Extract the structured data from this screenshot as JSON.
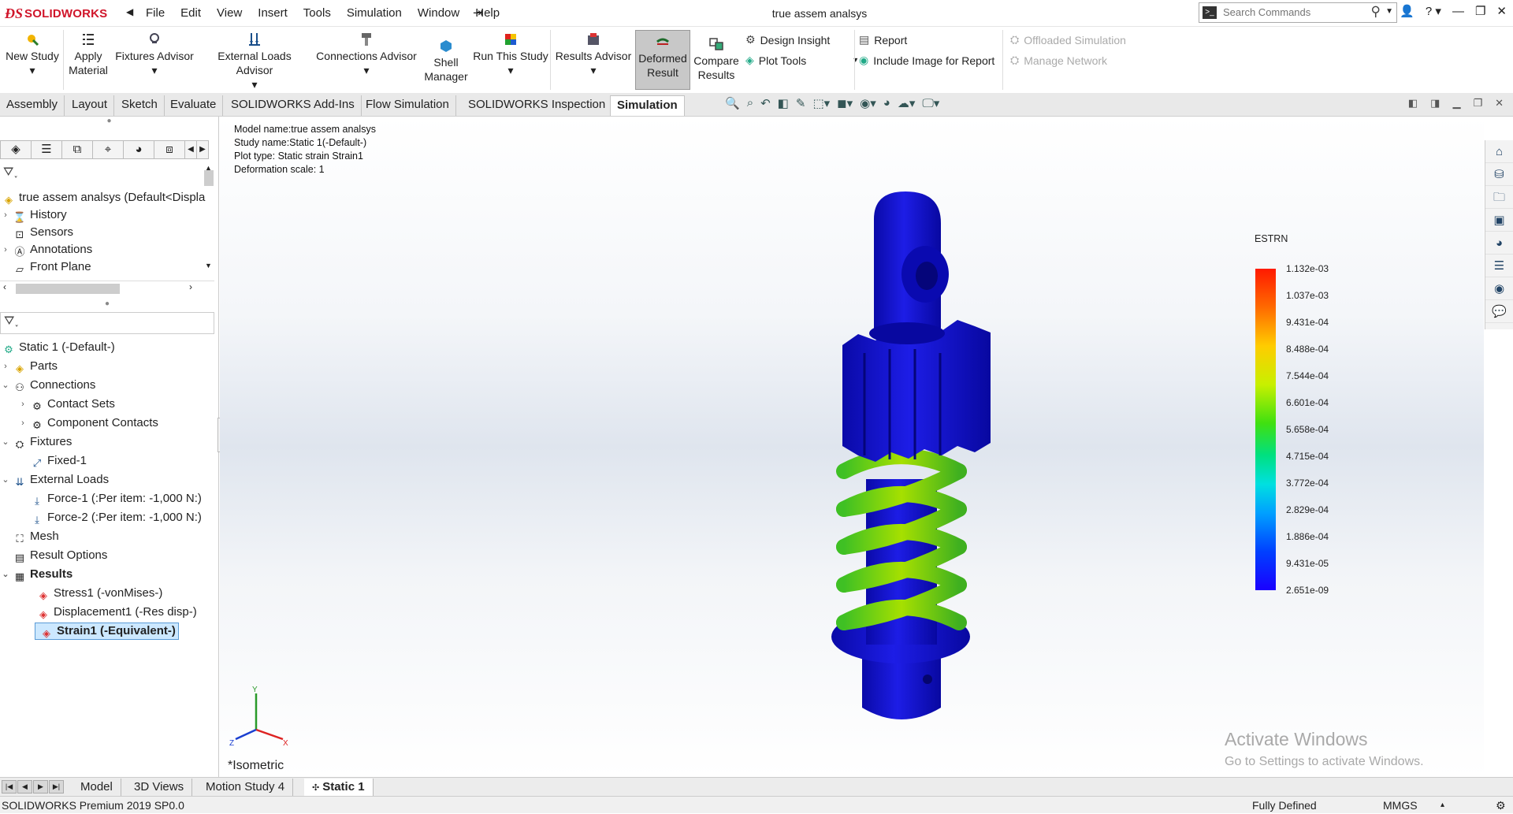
{
  "titlebar": {
    "app_name": "SOLIDWORKS",
    "menu": [
      "File",
      "Edit",
      "View",
      "Insert",
      "Tools",
      "Simulation",
      "Window",
      "Help"
    ],
    "document_title": "true assem analsys",
    "search_placeholder": "Search Commands"
  },
  "ribbon": {
    "new_study": "New Study",
    "apply_material_1": "Apply",
    "apply_material_2": "Material",
    "fixtures_advisor": "Fixtures Advisor",
    "external_loads_advisor": "External Loads Advisor",
    "connections_advisor": "Connections Advisor",
    "shell_manager_1": "Shell",
    "shell_manager_2": "Manager",
    "run_this_study": "Run This Study",
    "results_advisor": "Results Advisor",
    "deformed_result_1": "Deformed",
    "deformed_result_2": "Result",
    "compare_results_1": "Compare",
    "compare_results_2": "Results",
    "design_insight": "Design Insight",
    "plot_tools": "Plot Tools",
    "report": "Report",
    "include_image": "Include Image for Report",
    "offloaded_simulation": "Offloaded Simulation",
    "manage_network": "Manage Network"
  },
  "command_tabs": [
    "Assembly",
    "Layout",
    "Sketch",
    "Evaluate",
    "SOLIDWORKS Add-Ins",
    "Flow Simulation",
    "SOLIDWORKS Inspection",
    "Simulation"
  ],
  "feature_tree": {
    "root": "true assem analsys  (Default<Displa",
    "items": [
      "History",
      "Sensors",
      "Annotations",
      "Front Plane"
    ]
  },
  "study_tree": {
    "study": "Static 1 (-Default-)",
    "parts": "Parts",
    "connections": "Connections",
    "contact_sets": "Contact Sets",
    "component_contacts": "Component Contacts",
    "fixtures": "Fixtures",
    "fixed_1": "Fixed-1",
    "external_loads": "External Loads",
    "force_1": "Force-1 (:Per item: -1,000 N:)",
    "force_2": "Force-2 (:Per item: -1,000 N:)",
    "mesh": "Mesh",
    "result_options": "Result Options",
    "results": "Results",
    "stress1": "Stress1 (-vonMises-)",
    "displacement1": "Displacement1 (-Res disp-)",
    "strain1": "Strain1 (-Equivalent-)"
  },
  "viewport": {
    "model_name": "Model name:true assem analsys",
    "study_name": "Study name:Static 1(-Default-)",
    "plot_type": "Plot type: Static strain Strain1",
    "deformation_scale": "Deformation scale: 1",
    "legend_title": "ESTRN",
    "legend_ticks": [
      "1.132e-03",
      "1.037e-03",
      "9.431e-04",
      "8.488e-04",
      "7.544e-04",
      "6.601e-04",
      "5.658e-04",
      "4.715e-04",
      "3.772e-04",
      "2.829e-04",
      "1.886e-04",
      "9.431e-05",
      "2.651e-09"
    ],
    "view_orientation": "*Isometric",
    "activate_title": "Activate Windows",
    "activate_sub": "Go to Settings to activate Windows."
  },
  "bottom_tabs": [
    "Model",
    "3D Views",
    "Motion Study 4",
    "Static 1"
  ],
  "status": {
    "version": "SOLIDWORKS Premium 2019 SP0.0",
    "state": "Fully Defined",
    "units": "MMGS"
  },
  "colors": {
    "brand": "#d0152a",
    "model_body": "#1010c8",
    "spring": "#4cc020"
  }
}
